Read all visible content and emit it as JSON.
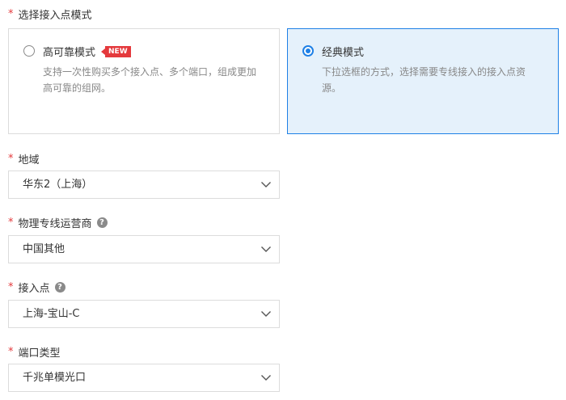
{
  "mode_section": {
    "required_mark": "*",
    "label": "选择接入点模式",
    "options": [
      {
        "title": "高可靠模式",
        "badge": "NEW",
        "description": "支持一次性购买多个接入点、多个端口，组成更加高可靠的组网。",
        "selected": false
      },
      {
        "title": "经典模式",
        "description": "下拉选框的方式，选择需要专线接入的接入点资源。",
        "selected": true
      }
    ]
  },
  "region": {
    "required_mark": "*",
    "label": "地域",
    "value": "华东2（上海）"
  },
  "provider": {
    "required_mark": "*",
    "label": "物理专线运营商",
    "help": "?",
    "value": "中国其他"
  },
  "access_point": {
    "required_mark": "*",
    "label": "接入点",
    "help": "?",
    "value": "上海-宝山-C"
  },
  "port_type": {
    "required_mark": "*",
    "label": "端口类型",
    "value": "千兆单模光口"
  },
  "colors": {
    "accent": "#1e80e6",
    "selected_bg": "#e5f1fb",
    "required": "#e4393c",
    "badge": "#e4393c"
  }
}
